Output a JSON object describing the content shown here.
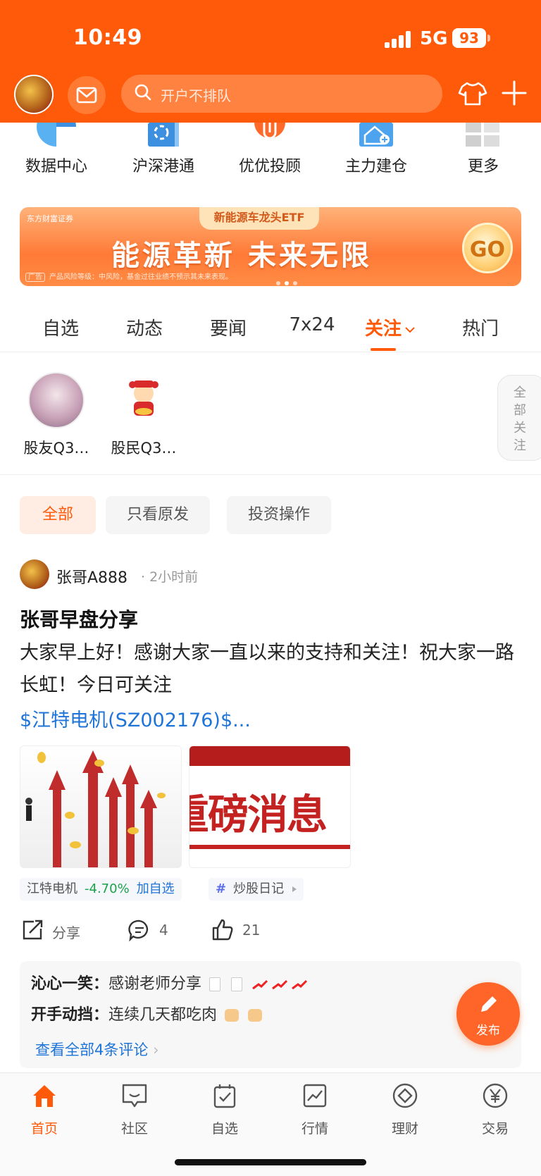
{
  "status_bar": {
    "time": "10:49",
    "network": "5G",
    "battery": "93"
  },
  "header": {
    "search_placeholder": "开户不排队"
  },
  "quick_entries": [
    {
      "label": "数据中心",
      "icon": "pie-chart-icon"
    },
    {
      "label": "沪深港通",
      "icon": "bauhinia-icon"
    },
    {
      "label": "优优投顾",
      "icon": "clip-icon"
    },
    {
      "label": "主力建仓",
      "icon": "house-plus-icon"
    },
    {
      "label": "更多",
      "icon": "grid-icon"
    }
  ],
  "banner": {
    "tag": "新能源车龙头ETF",
    "headline": "能源革新 未来无限",
    "brand": "东方财富证券",
    "ad_label": "广告",
    "risk_text": "产品风险等级：中风险，基金过往业绩不预示其未来表现。",
    "cta": "GO"
  },
  "tabs": [
    {
      "label": "自选"
    },
    {
      "label": "动态"
    },
    {
      "label": "要闻"
    },
    {
      "label": "7x24"
    },
    {
      "label": "关注",
      "active": true
    },
    {
      "label": "热门"
    }
  ],
  "following": {
    "users": [
      {
        "name": "股友Q3…"
      },
      {
        "name": "股民Q3…"
      }
    ],
    "all_label": "全部关注"
  },
  "filters": [
    {
      "label": "全部",
      "active": true
    },
    {
      "label": "只看原发"
    },
    {
      "label": "投资操作"
    }
  ],
  "post": {
    "author": "张哥A888",
    "time": "2小时前",
    "title": "张哥早盘分享",
    "body": "大家早上好！感谢大家一直以来的支持和关注！祝大家一路长虹！今日可关注",
    "link": "$江特电机(SZ002176)$...",
    "image2_text": "重磅消息",
    "stock": {
      "name": "江特电机",
      "change": "-4.70%",
      "add_label": "加自选"
    },
    "topic": "炒股日记",
    "actions": {
      "share": "分享",
      "comments": "4",
      "likes": "21"
    },
    "comments": [
      {
        "user": "沁心一笑：",
        "text": "感谢老师分享"
      },
      {
        "user": "开手动挡：",
        "text": "连续几天都吃肉"
      }
    ],
    "more_comments": "查看全部4条评论"
  },
  "fab": {
    "label": "发布"
  },
  "bottom_nav": [
    {
      "label": "首页",
      "active": true
    },
    {
      "label": "社区"
    },
    {
      "label": "自选"
    },
    {
      "label": "行情"
    },
    {
      "label": "理财"
    },
    {
      "label": "交易"
    }
  ],
  "colors": {
    "accent": "#ff5a0a",
    "link": "#1e74d8",
    "down": "#1aa34a"
  }
}
